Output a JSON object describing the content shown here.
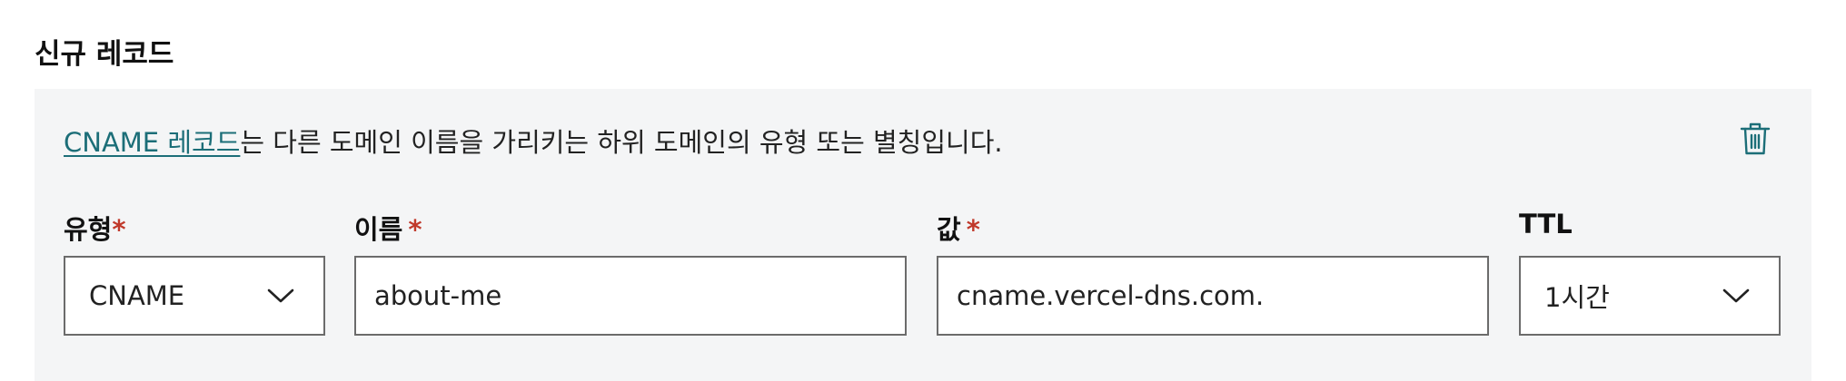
{
  "section": {
    "title": "신규 레코드"
  },
  "description": {
    "link_text": "CNAME 레코드",
    "text": "는 다른 도메인 이름을 가리키는 하위 도메인의 유형 또는 별칭입니다."
  },
  "delete_icon": "trash-icon",
  "fields": {
    "type": {
      "label": "유형",
      "required_mark": "*",
      "value": "CNAME"
    },
    "name": {
      "label": "이름",
      "required_mark": "*",
      "value": "about-me"
    },
    "value": {
      "label": "값",
      "required_mark": "*",
      "value": "cname.vercel-dns.com."
    },
    "ttl": {
      "label": "TTL",
      "value": "1시간"
    }
  },
  "colors": {
    "link": "#1c6e78",
    "required": "#c0392b",
    "panel_bg": "#f4f5f6",
    "border": "#6b6b6b"
  }
}
